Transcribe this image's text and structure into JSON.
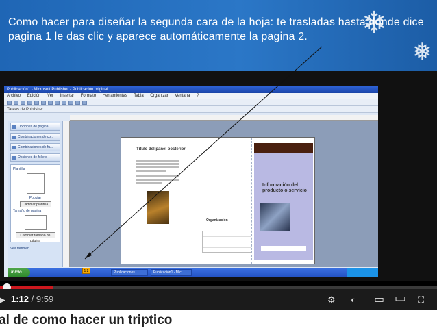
{
  "banner": {
    "text": "Como hacer para diseñar la segunda cara de la hoja:  te trasladas hasta donde dice pagina 1 le das clic y aparece automáticamente la pagina 2."
  },
  "screen": {
    "title": "Publicación1 - Microsoft Publisher - Publicación original",
    "menu": [
      "Archivo",
      "Edición",
      "Ver",
      "Insertar",
      "Formato",
      "Herramientas",
      "Tabla",
      "Organizar",
      "Ventana",
      "?"
    ],
    "toolbar_label": "Tareas de Publisher",
    "taskpane": {
      "items": [
        "Opciones de página",
        "Combinaciones de co...",
        "Combinaciones de fu...",
        "Opciones de folleto"
      ],
      "plantilla_label": "Plantilla",
      "popular_label": "Popular",
      "change_template": "Cambiar plantilla",
      "page_size_label": "Tamaño de página",
      "change_size": "Cambiar tamaño de página",
      "footer": "Vea también"
    },
    "brochure": {
      "left_title": "Título del panel posterior",
      "right_title": "Información del producto o servicio",
      "org_name": "Organización"
    },
    "page_number": "1 2",
    "taskbar": {
      "start": "Inicio",
      "items": [
        "Publicaciones",
        "Publicación1 - Mic..."
      ]
    }
  },
  "player": {
    "current_time": "1:12",
    "duration": " / 9:59",
    "progress_fraction": 0.12,
    "icons": [
      "play-icon",
      "next-icon",
      "volume-icon",
      "settings-icon",
      "watch-later-icon",
      "miniplayer-icon",
      "theater-icon",
      "fullscreen-icon"
    ]
  },
  "video_title": "al de como hacer un triptico"
}
